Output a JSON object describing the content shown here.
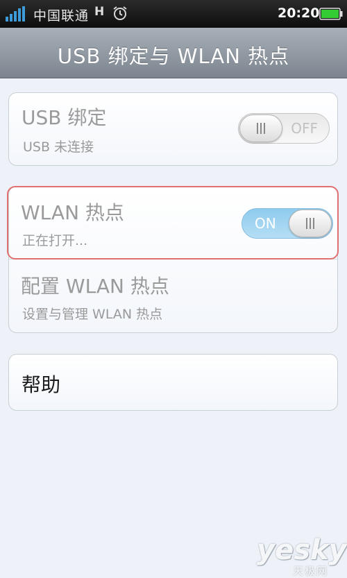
{
  "status_bar": {
    "carrier": "中国联通",
    "network_type": "H",
    "time": "20:20",
    "icons": [
      "signal-icon",
      "alarm-icon",
      "battery-icon"
    ]
  },
  "header": {
    "title": "USB 绑定与 WLAN 热点"
  },
  "settings": {
    "usb_tethering": {
      "title": "USB 绑定",
      "subtitle": "USB 未连接",
      "toggle_label": "OFF"
    },
    "wlan_hotspot": {
      "title": "WLAN 热点",
      "subtitle": "正在打开...",
      "toggle_label": "ON"
    },
    "configure_hotspot": {
      "title": "配置 WLAN 热点",
      "subtitle": "设置与管理 WLAN 热点"
    },
    "help": {
      "title": "帮助"
    }
  },
  "watermark": {
    "main": "yesky",
    "sub": "天极网"
  },
  "colors": {
    "title_bar": "#8e969f",
    "background": "#eef2f8",
    "toggle_on": "#9fd3f0",
    "highlight_border": "#e06f6f",
    "battery": "#33cc33"
  }
}
